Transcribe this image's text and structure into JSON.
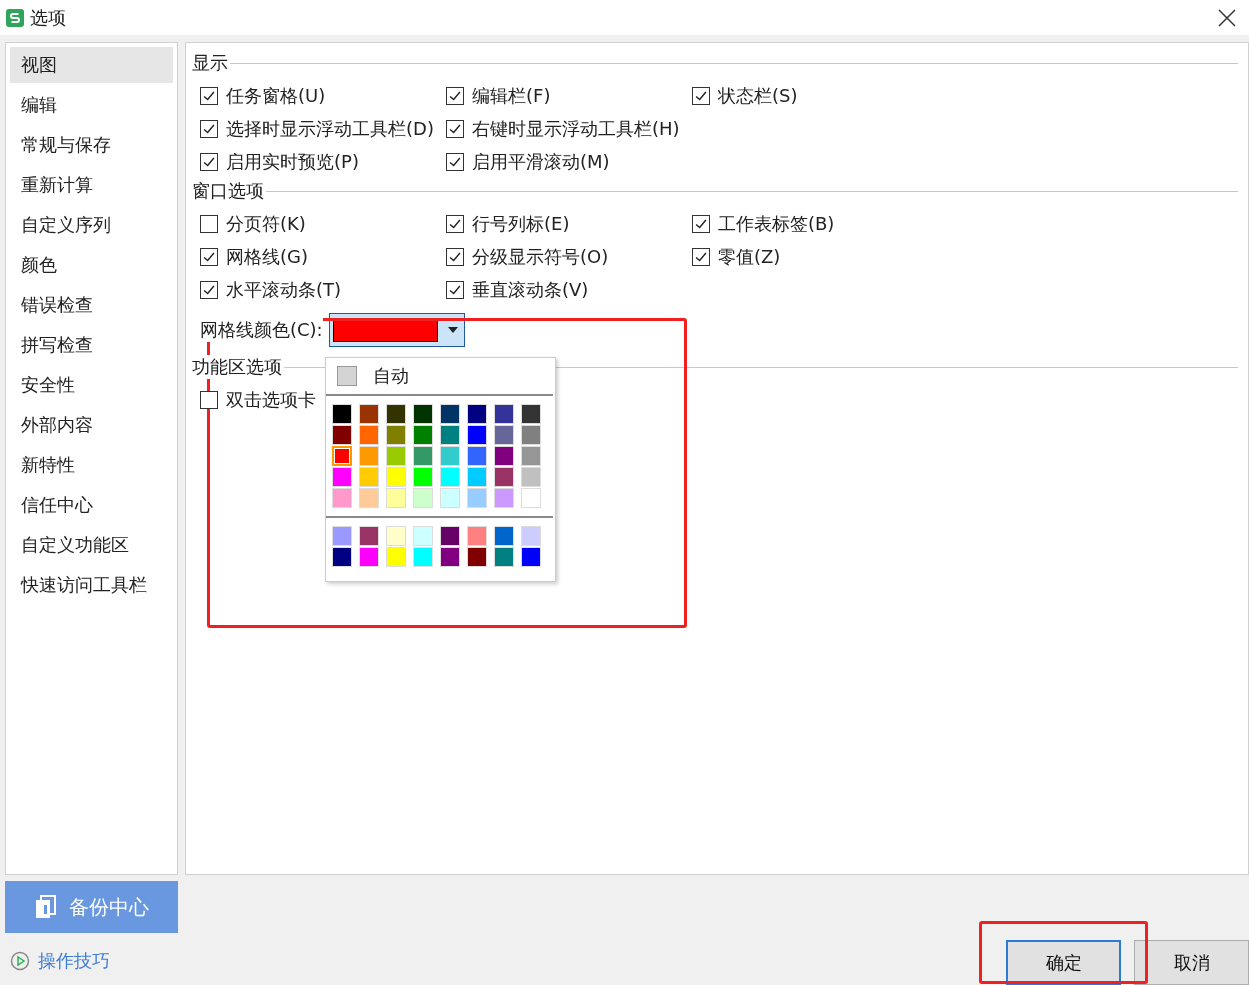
{
  "window": {
    "title": "选项"
  },
  "sidebar": {
    "items": [
      {
        "label": "视图",
        "selected": true
      },
      {
        "label": "编辑",
        "selected": false
      },
      {
        "label": "常规与保存",
        "selected": false
      },
      {
        "label": "重新计算",
        "selected": false
      },
      {
        "label": "自定义序列",
        "selected": false
      },
      {
        "label": "颜色",
        "selected": false
      },
      {
        "label": "错误检查",
        "selected": false
      },
      {
        "label": "拼写检查",
        "selected": false
      },
      {
        "label": "安全性",
        "selected": false
      },
      {
        "label": "外部内容",
        "selected": false
      },
      {
        "label": "新特性",
        "selected": false
      },
      {
        "label": "信任中心",
        "selected": false
      },
      {
        "label": "自定义功能区",
        "selected": false
      },
      {
        "label": "快速访问工具栏",
        "selected": false
      }
    ]
  },
  "sections": [
    {
      "title": "显示",
      "rows": [
        [
          {
            "label": "任务窗格(U)",
            "checked": true
          },
          {
            "label": "编辑栏(F)",
            "checked": true
          },
          {
            "label": "状态栏(S)",
            "checked": true
          }
        ],
        [
          {
            "label": "选择时显示浮动工具栏(D)",
            "checked": true
          },
          {
            "label": "右键时显示浮动工具栏(H)",
            "checked": true
          }
        ],
        [
          {
            "label": "启用实时预览(P)",
            "checked": true
          },
          {
            "label": "启用平滑滚动(M)",
            "checked": true
          }
        ]
      ]
    },
    {
      "title": "窗口选项",
      "rows": [
        [
          {
            "label": "分页符(K)",
            "checked": false
          },
          {
            "label": "行号列标(E)",
            "checked": true
          },
          {
            "label": "工作表标签(B)",
            "checked": true
          }
        ],
        [
          {
            "label": "网格线(G)",
            "checked": true
          },
          {
            "label": "分级显示符号(O)",
            "checked": true
          },
          {
            "label": "零值(Z)",
            "checked": true
          }
        ],
        [
          {
            "label": "水平滚动条(T)",
            "checked": true
          },
          {
            "label": "垂直滚动条(V)",
            "checked": true
          }
        ]
      ],
      "gridline_color": {
        "label": "网格线颜色(C):",
        "color": "#ff0000"
      }
    },
    {
      "title": "功能区选项",
      "rows": [
        [
          {
            "label": "双击选项卡",
            "checked": false
          }
        ]
      ]
    }
  ],
  "color_popup": {
    "auto_label": "自动",
    "palette": [
      {
        "color": "#000000",
        "selected": false
      },
      {
        "color": "#993300",
        "selected": false
      },
      {
        "color": "#333300",
        "selected": false
      },
      {
        "color": "#003300",
        "selected": false
      },
      {
        "color": "#003366",
        "selected": false
      },
      {
        "color": "#000080",
        "selected": false
      },
      {
        "color": "#333399",
        "selected": false
      },
      {
        "color": "#333333",
        "selected": false
      },
      {
        "color": "#800000",
        "selected": false
      },
      {
        "color": "#ff6600",
        "selected": false
      },
      {
        "color": "#808000",
        "selected": false
      },
      {
        "color": "#008000",
        "selected": false
      },
      {
        "color": "#008080",
        "selected": false
      },
      {
        "color": "#0000ff",
        "selected": false
      },
      {
        "color": "#666699",
        "selected": false
      },
      {
        "color": "#808080",
        "selected": false
      },
      {
        "color": "#ff0000",
        "selected": true
      },
      {
        "color": "#ff9900",
        "selected": false
      },
      {
        "color": "#99cc00",
        "selected": false
      },
      {
        "color": "#339966",
        "selected": false
      },
      {
        "color": "#33cccc",
        "selected": false
      },
      {
        "color": "#3366ff",
        "selected": false
      },
      {
        "color": "#800080",
        "selected": false
      },
      {
        "color": "#969696",
        "selected": false
      },
      {
        "color": "#ff00ff",
        "selected": false
      },
      {
        "color": "#ffcc00",
        "selected": false
      },
      {
        "color": "#ffff00",
        "selected": false
      },
      {
        "color": "#00ff00",
        "selected": false
      },
      {
        "color": "#00ffff",
        "selected": false
      },
      {
        "color": "#00ccff",
        "selected": false
      },
      {
        "color": "#993366",
        "selected": false
      },
      {
        "color": "#c0c0c0",
        "selected": false
      },
      {
        "color": "#ff99cc",
        "selected": false
      },
      {
        "color": "#ffcc99",
        "selected": false
      },
      {
        "color": "#ffff99",
        "selected": false
      },
      {
        "color": "#ccffcc",
        "selected": false
      },
      {
        "color": "#ccffff",
        "selected": false
      },
      {
        "color": "#99ccff",
        "selected": false
      },
      {
        "color": "#cc99ff",
        "selected": false
      },
      {
        "color": "#ffffff",
        "selected": false
      }
    ],
    "extra": [
      {
        "color": "#9999ff",
        "selected": false
      },
      {
        "color": "#993366",
        "selected": false
      },
      {
        "color": "#ffffcc",
        "selected": false
      },
      {
        "color": "#ccffff",
        "selected": false
      },
      {
        "color": "#660066",
        "selected": false
      },
      {
        "color": "#ff8080",
        "selected": false
      },
      {
        "color": "#0066cc",
        "selected": false
      },
      {
        "color": "#ccccff",
        "selected": false
      },
      {
        "color": "#000080",
        "selected": false
      },
      {
        "color": "#ff00ff",
        "selected": false
      },
      {
        "color": "#ffff00",
        "selected": false
      },
      {
        "color": "#00ffff",
        "selected": false
      },
      {
        "color": "#800080",
        "selected": false
      },
      {
        "color": "#800000",
        "selected": false
      },
      {
        "color": "#008080",
        "selected": false
      },
      {
        "color": "#0000ff",
        "selected": false
      }
    ]
  },
  "backup_button": {
    "label": "备份中心"
  },
  "tips_link": {
    "label": "操作技巧"
  },
  "buttons": [
    {
      "label": "确定",
      "kind": "primary"
    },
    {
      "label": "取消",
      "kind": "normal"
    }
  ],
  "annotations": [
    {
      "kind": "highlight"
    },
    {
      "kind": "highlight"
    }
  ]
}
